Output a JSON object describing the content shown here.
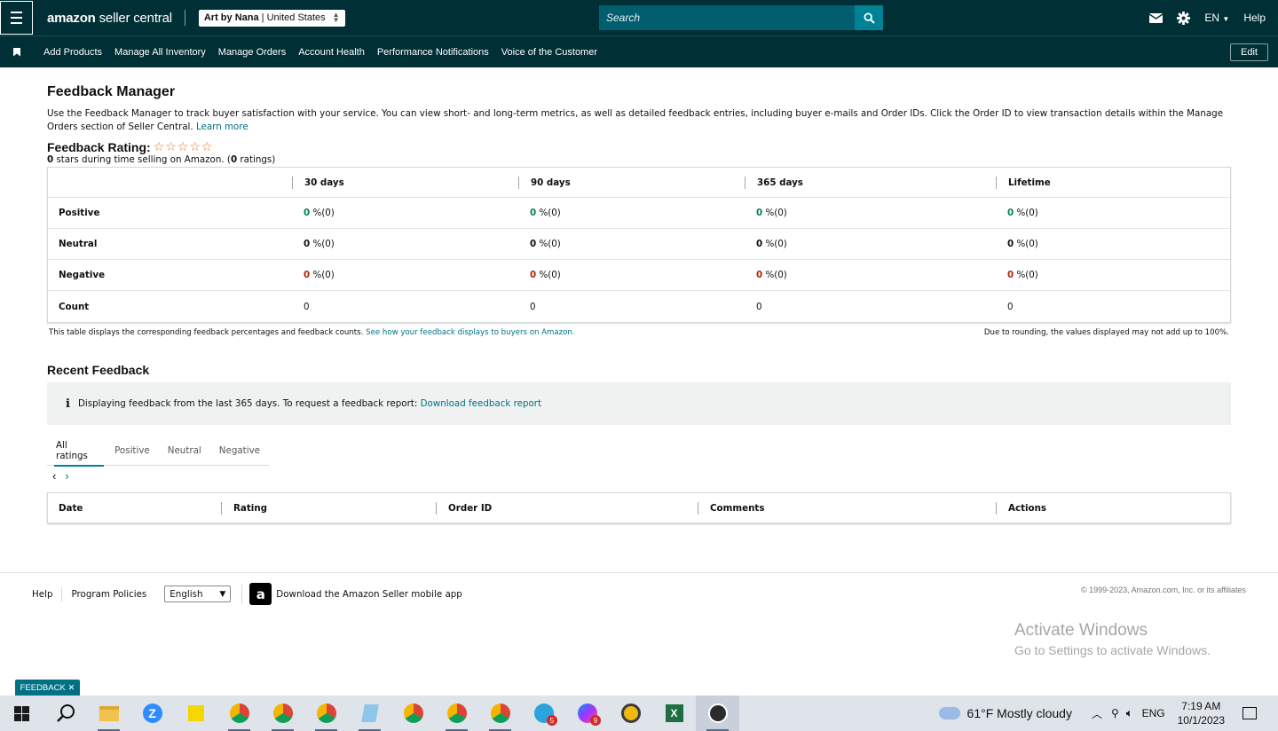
{
  "topbar": {
    "logo_brand": "amazon",
    "logo_rest": " seller central",
    "store_name": "Art by Nana",
    "store_region": "United States",
    "search_placeholder": "Search",
    "lang": "EN",
    "help": "Help"
  },
  "navbar": {
    "links": [
      "Add Products",
      "Manage All Inventory",
      "Manage Orders",
      "Account Health",
      "Performance Notifications",
      "Voice of the Customer"
    ],
    "edit": "Edit"
  },
  "page": {
    "title": "Feedback Manager",
    "description": "Use the Feedback Manager to track buyer satisfaction with your service. You can view short- and long-term metrics, as well as detailed feedback entries, including buyer e-mails and Order IDs. Click the Order ID to view transaction details within the Manage Orders section of Seller Central.",
    "learn_more": "Learn more",
    "rating_label": "Feedback Rating:",
    "stars": "☆☆☆☆☆",
    "rating_stars_count": "0",
    "rating_sub_mid": " stars during time selling on Amazon. (",
    "rating_count": "0",
    "rating_sub_end": " ratings)"
  },
  "feedback_table": {
    "columns": [
      "",
      "30 days",
      "90 days",
      "365 days",
      "Lifetime"
    ],
    "rows": [
      {
        "label": "Positive",
        "cells": [
          {
            "v": "0",
            "p": " %(0)"
          },
          {
            "v": "0",
            "p": " %(0)"
          },
          {
            "v": "0",
            "p": " %(0)"
          },
          {
            "v": "0",
            "p": " %(0)"
          }
        ]
      },
      {
        "label": "Neutral",
        "cells": [
          {
            "v": "0",
            "p": " %(0)"
          },
          {
            "v": "0",
            "p": " %(0)"
          },
          {
            "v": "0",
            "p": " %(0)"
          },
          {
            "v": "0",
            "p": " %(0)"
          }
        ]
      },
      {
        "label": "Negative",
        "cells": [
          {
            "v": "0",
            "p": " %(0)"
          },
          {
            "v": "0",
            "p": " %(0)"
          },
          {
            "v": "0",
            "p": " %(0)"
          },
          {
            "v": "0",
            "p": " %(0)"
          }
        ]
      },
      {
        "label": "Count",
        "cells": [
          "0",
          "0",
          "0",
          "0"
        ]
      }
    ],
    "note_left": "This table displays the corresponding feedback percentages and feedback counts.",
    "note_link": "See how your feedback displays to buyers on Amazon.",
    "note_right": "Due to rounding, the values displayed may not add up to 100%."
  },
  "recent": {
    "title": "Recent Feedback",
    "info_text": "Displaying feedback from the last 365 days. To request a feedback report:",
    "info_link": "Download feedback report",
    "tabs": [
      "All ratings",
      "Positive",
      "Neutral",
      "Negative"
    ],
    "pager_prev": "‹",
    "pager_next": "›",
    "columns": [
      "Date",
      "Rating",
      "Order ID",
      "Comments",
      "Actions"
    ]
  },
  "footer": {
    "help": "Help",
    "policies": "Program Policies",
    "language": "English",
    "app_icon": "a",
    "app_text": "Download the Amazon Seller mobile app",
    "copyright": "© 1999-2023, Amazon.com, Inc. or its affiliates"
  },
  "watermark": {
    "line1": "Activate Windows",
    "line2": "Go to Settings to activate Windows."
  },
  "feedback_button": "FEEDBACK ✕",
  "taskbar": {
    "weather": "61°F  Mostly cloudy",
    "lang": "ENG",
    "time": "7:19 AM",
    "date": "10/1/2023",
    "badges": [
      "5",
      "9"
    ]
  }
}
